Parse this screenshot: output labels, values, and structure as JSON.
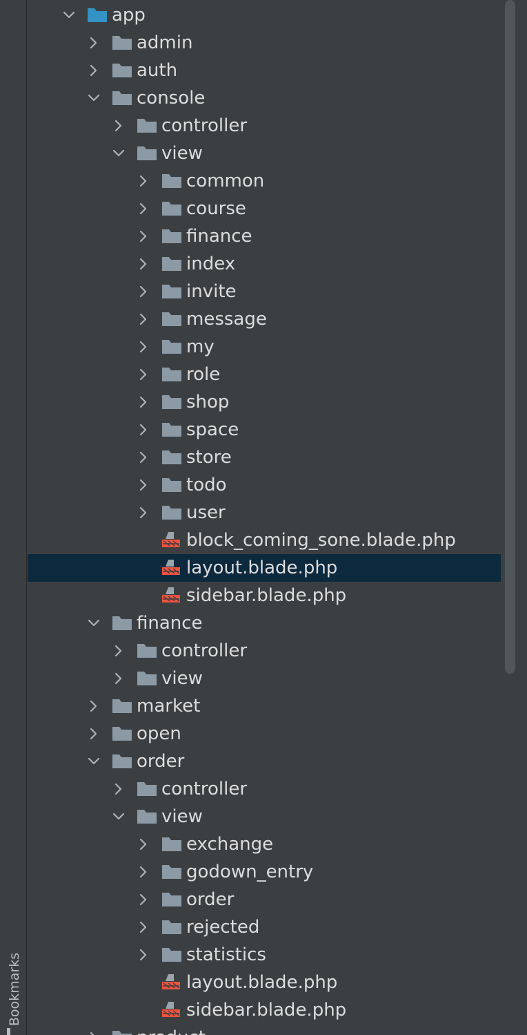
{
  "sidebar": {
    "bookmarks_label": "Bookmarks"
  },
  "colors": {
    "background": "#3c3f41",
    "text": "#dcdcdc",
    "selection": "#0d293e",
    "folder": "#8c9aa6",
    "app_folder": "#3592c4",
    "blade_icon": "#f05340"
  },
  "tree": {
    "rows": [
      {
        "label": "app",
        "depth": 0,
        "expanded": true,
        "kind": "app-folder"
      },
      {
        "label": "admin",
        "depth": 1,
        "expanded": false,
        "kind": "folder"
      },
      {
        "label": "auth",
        "depth": 1,
        "expanded": false,
        "kind": "folder"
      },
      {
        "label": "console",
        "depth": 1,
        "expanded": true,
        "kind": "folder"
      },
      {
        "label": "controller",
        "depth": 2,
        "expanded": false,
        "kind": "folder"
      },
      {
        "label": "view",
        "depth": 2,
        "expanded": true,
        "kind": "folder"
      },
      {
        "label": "common",
        "depth": 3,
        "expanded": false,
        "kind": "folder"
      },
      {
        "label": "course",
        "depth": 3,
        "expanded": false,
        "kind": "folder"
      },
      {
        "label": "finance",
        "depth": 3,
        "expanded": false,
        "kind": "folder"
      },
      {
        "label": "index",
        "depth": 3,
        "expanded": false,
        "kind": "folder"
      },
      {
        "label": "invite",
        "depth": 3,
        "expanded": false,
        "kind": "folder"
      },
      {
        "label": "message",
        "depth": 3,
        "expanded": false,
        "kind": "folder"
      },
      {
        "label": "my",
        "depth": 3,
        "expanded": false,
        "kind": "folder"
      },
      {
        "label": "role",
        "depth": 3,
        "expanded": false,
        "kind": "folder"
      },
      {
        "label": "shop",
        "depth": 3,
        "expanded": false,
        "kind": "folder"
      },
      {
        "label": "space",
        "depth": 3,
        "expanded": false,
        "kind": "folder"
      },
      {
        "label": "store",
        "depth": 3,
        "expanded": false,
        "kind": "folder"
      },
      {
        "label": "todo",
        "depth": 3,
        "expanded": false,
        "kind": "folder"
      },
      {
        "label": "user",
        "depth": 3,
        "expanded": false,
        "kind": "folder"
      },
      {
        "label": "block_coming_sone.blade.php",
        "depth": 3,
        "kind": "blade-file"
      },
      {
        "label": "layout.blade.php",
        "depth": 3,
        "kind": "blade-file",
        "selected": true
      },
      {
        "label": "sidebar.blade.php",
        "depth": 3,
        "kind": "blade-file"
      },
      {
        "label": "finance",
        "depth": 1,
        "expanded": true,
        "kind": "folder"
      },
      {
        "label": "controller",
        "depth": 2,
        "expanded": false,
        "kind": "folder"
      },
      {
        "label": "view",
        "depth": 2,
        "expanded": false,
        "kind": "folder"
      },
      {
        "label": "market",
        "depth": 1,
        "expanded": false,
        "kind": "folder"
      },
      {
        "label": "open",
        "depth": 1,
        "expanded": false,
        "kind": "folder"
      },
      {
        "label": "order",
        "depth": 1,
        "expanded": true,
        "kind": "folder"
      },
      {
        "label": "controller",
        "depth": 2,
        "expanded": false,
        "kind": "folder"
      },
      {
        "label": "view",
        "depth": 2,
        "expanded": true,
        "kind": "folder"
      },
      {
        "label": "exchange",
        "depth": 3,
        "expanded": false,
        "kind": "folder"
      },
      {
        "label": "godown_entry",
        "depth": 3,
        "expanded": false,
        "kind": "folder"
      },
      {
        "label": "order",
        "depth": 3,
        "expanded": false,
        "kind": "folder"
      },
      {
        "label": "rejected",
        "depth": 3,
        "expanded": false,
        "kind": "folder"
      },
      {
        "label": "statistics",
        "depth": 3,
        "expanded": false,
        "kind": "folder"
      },
      {
        "label": "layout.blade.php",
        "depth": 3,
        "kind": "blade-file"
      },
      {
        "label": "sidebar.blade.php",
        "depth": 3,
        "kind": "blade-file"
      },
      {
        "label": "product",
        "depth": 1,
        "expanded": false,
        "kind": "folder"
      }
    ]
  }
}
